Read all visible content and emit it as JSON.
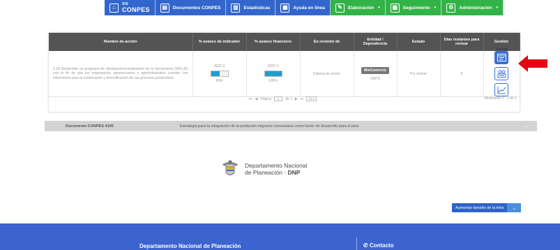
{
  "nav": {
    "logo_top": "SIS",
    "logo_bottom": "CONPES",
    "items": [
      {
        "label": "Documentos CONPES",
        "caret": ""
      },
      {
        "label": "Estadísticas",
        "caret": ""
      },
      {
        "label": "Ayuda en línea",
        "caret": ""
      },
      {
        "label": "Elaboración",
        "caret": "▾"
      },
      {
        "label": "Seguimiento",
        "caret": "▾"
      },
      {
        "label": "Administración",
        "caret": "▾"
      }
    ]
  },
  "table": {
    "headers": {
      "accion": "Nombre de acción",
      "indicador": "% avance de indicador",
      "financiero": "% avance financiero",
      "revision": "En revisión de",
      "entidad": "Entidad / Dependencia",
      "estado": "Estado",
      "dias": "Días restantes para revisar",
      "gestion": "Gestión"
    },
    "row": {
      "accion": "1.18 Desarrollar un programa de divulgación/socialización de la herramienta DATLAS con el fin de que los empresarios agropecuarios y agroindustriales cuenten con información para la sofisticación y diversificación de sus procesos productivos.",
      "indicador_period": "2022-2",
      "indicador_value": "50%",
      "indicador_fraction": 0.5,
      "financiero_period": "2022-2",
      "financiero_value": "100%",
      "financiero_fraction": 1.0,
      "revision": "Cabeza de sector",
      "entidad_badge": "MinComercio",
      "entidad_sub": "OAPS",
      "estado": "Por revisar",
      "dias": "8"
    },
    "tooltip": "Revisar"
  },
  "pager": {
    "pagina_label": "Página",
    "page": "1",
    "de_label": "de 1",
    "page_size": "10",
    "summary": "Mostrando 1 - 1 de 1"
  },
  "document": {
    "label": "Documento CONPES 4100",
    "description": "Estrategia para la integración de la población migrante venezolana como factor de desarrollo para el país"
  },
  "logo": {
    "line1": "Departamento Nacional",
    "line2_prefix": "de Planeación - ",
    "line2_bold": "DNP"
  },
  "font_button": {
    "label": "Aumentar tamaño de la letra"
  },
  "footer": {
    "left_title": "Departamento Nacional de Planeación",
    "right_title": "Contacto"
  },
  "colors": {
    "nav_blue": "#3366cc",
    "nav_green": "#33b347",
    "header_gray": "#545454",
    "accent_blue": "#3d6fd1",
    "footer_blue": "#3d63cf",
    "arrow_red": "#e30613"
  }
}
